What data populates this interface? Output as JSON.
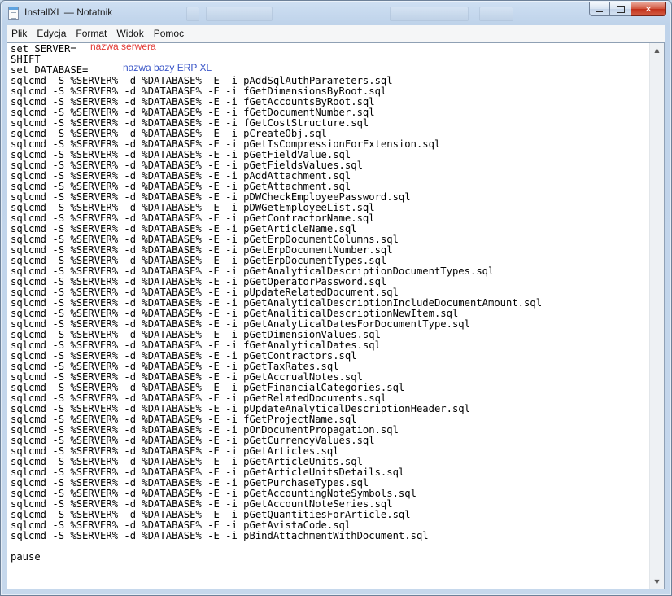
{
  "window": {
    "title": "InstallXL — Notatnik",
    "buttons": {
      "minimize": "minimize",
      "maximize": "maximize",
      "close": "✕"
    }
  },
  "menu": [
    "Plik",
    "Edycja",
    "Format",
    "Widok",
    "Pomoc"
  ],
  "editor": {
    "annotations": {
      "server": "nazwa serwera",
      "database": "nazwa bazy ERP XL"
    },
    "lines": [
      "set SERVER=",
      "SHIFT",
      "set DATABASE=",
      "sqlcmd -S %SERVER% -d %DATABASE% -E -i pAddSqlAuthParameters.sql",
      "sqlcmd -S %SERVER% -d %DATABASE% -E -i fGetDimensionsByRoot.sql",
      "sqlcmd -S %SERVER% -d %DATABASE% -E -i fGetAccountsByRoot.sql",
      "sqlcmd -S %SERVER% -d %DATABASE% -E -i fGetDocumentNumber.sql",
      "sqlcmd -S %SERVER% -d %DATABASE% -E -i fGetCostStructure.sql",
      "sqlcmd -S %SERVER% -d %DATABASE% -E -i pCreateObj.sql",
      "sqlcmd -S %SERVER% -d %DATABASE% -E -i pGetIsCompressionForExtension.sql",
      "sqlcmd -S %SERVER% -d %DATABASE% -E -i pGetFieldValue.sql",
      "sqlcmd -S %SERVER% -d %DATABASE% -E -i pGetFieldsValues.sql",
      "sqlcmd -S %SERVER% -d %DATABASE% -E -i pAddAttachment.sql",
      "sqlcmd -S %SERVER% -d %DATABASE% -E -i pGetAttachment.sql",
      "sqlcmd -S %SERVER% -d %DATABASE% -E -i pDWCheckEmployeePassword.sql",
      "sqlcmd -S %SERVER% -d %DATABASE% -E -i pDWGetEmployeeList.sql",
      "sqlcmd -S %SERVER% -d %DATABASE% -E -i pGetContractorName.sql",
      "sqlcmd -S %SERVER% -d %DATABASE% -E -i pGetArticleName.sql",
      "sqlcmd -S %SERVER% -d %DATABASE% -E -i pGetErpDocumentColumns.sql",
      "sqlcmd -S %SERVER% -d %DATABASE% -E -i pGetErpDocumentNumber.sql",
      "sqlcmd -S %SERVER% -d %DATABASE% -E -i pGetErpDocumentTypes.sql",
      "sqlcmd -S %SERVER% -d %DATABASE% -E -i pGetAnalyticalDescriptionDocumentTypes.sql",
      "sqlcmd -S %SERVER% -d %DATABASE% -E -i pGetOperatorPassword.sql",
      "sqlcmd -S %SERVER% -d %DATABASE% -E -i pUpdateRelatedDocument.sql",
      "sqlcmd -S %SERVER% -d %DATABASE% -E -i pGetAnalyticalDescriptionIncludeDocumentAmount.sql",
      "sqlcmd -S %SERVER% -d %DATABASE% -E -i pGetAnaliticalDescriptionNewItem.sql",
      "sqlcmd -S %SERVER% -d %DATABASE% -E -i pGetAnalyticalDatesForDocumentType.sql",
      "sqlcmd -S %SERVER% -d %DATABASE% -E -i pGetDimensionValues.sql",
      "sqlcmd -S %SERVER% -d %DATABASE% -E -i fGetAnalyticalDates.sql",
      "sqlcmd -S %SERVER% -d %DATABASE% -E -i pGetContractors.sql",
      "sqlcmd -S %SERVER% -d %DATABASE% -E -i pGetTaxRates.sql",
      "sqlcmd -S %SERVER% -d %DATABASE% -E -i pGetAccrualNotes.sql",
      "sqlcmd -S %SERVER% -d %DATABASE% -E -i pGetFinancialCategories.sql",
      "sqlcmd -S %SERVER% -d %DATABASE% -E -i pGetRelatedDocuments.sql",
      "sqlcmd -S %SERVER% -d %DATABASE% -E -i pUpdateAnalyticalDescriptionHeader.sql",
      "sqlcmd -S %SERVER% -d %DATABASE% -E -i fGetProjectName.sql",
      "sqlcmd -S %SERVER% -d %DATABASE% -E -i pOnDocumentPropagation.sql",
      "sqlcmd -S %SERVER% -d %DATABASE% -E -i pGetCurrencyValues.sql",
      "sqlcmd -S %SERVER% -d %DATABASE% -E -i pGetArticles.sql",
      "sqlcmd -S %SERVER% -d %DATABASE% -E -i pGetArticleUnits.sql",
      "sqlcmd -S %SERVER% -d %DATABASE% -E -i pGetArticleUnitsDetails.sql",
      "sqlcmd -S %SERVER% -d %DATABASE% -E -i pGetPurchaseTypes.sql",
      "sqlcmd -S %SERVER% -d %DATABASE% -E -i pGetAccountingNoteSymbols.sql",
      "sqlcmd -S %SERVER% -d %DATABASE% -E -i pGetAccountNoteSeries.sql",
      "sqlcmd -S %SERVER% -d %DATABASE% -E -i pGetQuantitiesForArticle.sql",
      "sqlcmd -S %SERVER% -d %DATABASE% -E -i pGetAvistaCode.sql",
      "sqlcmd -S %SERVER% -d %DATABASE% -E -i pBindAttachmentWithDocument.sql",
      "",
      "pause"
    ]
  },
  "scrollbar": {
    "up": "▲",
    "down": "▼"
  }
}
